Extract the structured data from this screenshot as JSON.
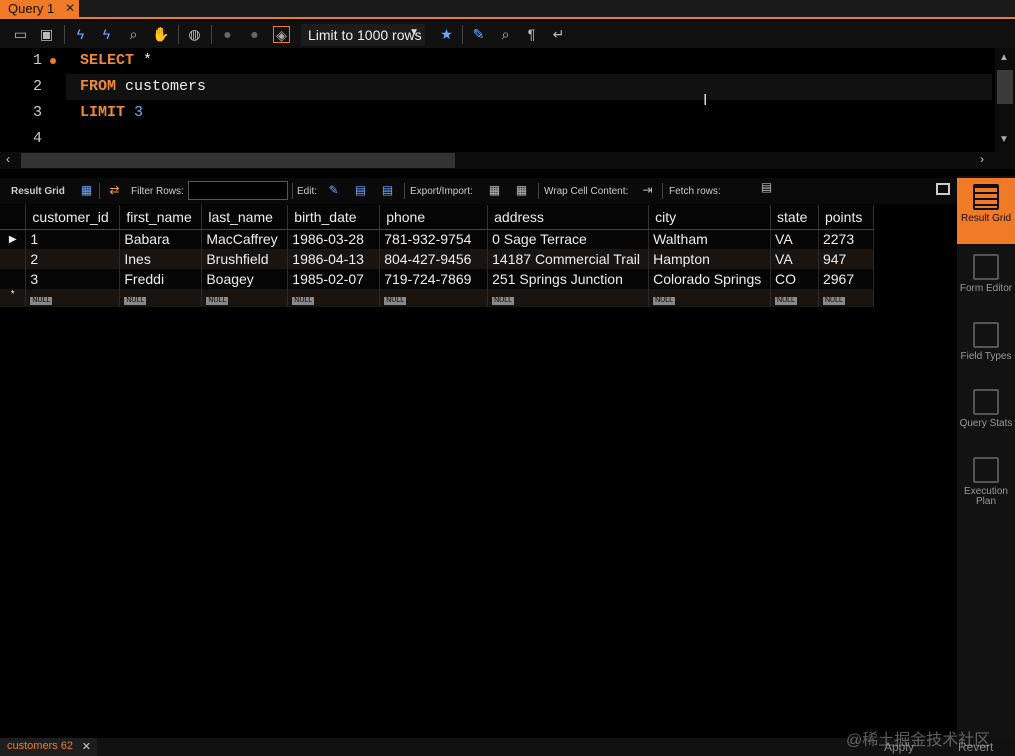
{
  "tab": {
    "title": "Query 1",
    "close": "✕"
  },
  "toolbar": {
    "limit_value": "Limit to 1000 rows"
  },
  "editor": {
    "lines": [
      {
        "number": "1",
        "keyword": "SELECT",
        "rest": " *"
      },
      {
        "number": "2",
        "keyword": "FROM",
        "rest": " customers"
      },
      {
        "number": "3",
        "keyword": "LIMIT",
        "rest": " 3"
      },
      {
        "number": "4",
        "keyword": "",
        "rest": ""
      }
    ]
  },
  "result_toolbar": {
    "result_grid": "Result Grid",
    "filter_rows": "Filter Rows:",
    "edit": "Edit:",
    "export_import": "Export/Import:",
    "wrap": "Wrap Cell Content:",
    "fetch": "Fetch rows:"
  },
  "grid": {
    "columns": [
      "customer_id",
      "first_name",
      "last_name",
      "birth_date",
      "phone",
      "address",
      "city",
      "state",
      "points"
    ],
    "rows": [
      [
        "1",
        "Babara",
        "MacCaffrey",
        "1986-03-28",
        "781-932-9754",
        "0 Sage Terrace",
        "Waltham",
        "VA",
        "2273"
      ],
      [
        "2",
        "Ines",
        "Brushfield",
        "1986-04-13",
        "804-427-9456",
        "14187 Commercial Trail",
        "Hampton",
        "VA",
        "947"
      ],
      [
        "3",
        "Freddi",
        "Boagey",
        "1985-02-07",
        "719-724-7869",
        "251 Springs Junction",
        "Colorado Springs",
        "CO",
        "2967"
      ]
    ],
    "null_label": "NULL"
  },
  "right_panel": {
    "items": [
      {
        "label": "Result Grid",
        "icon": "result-grid-icon"
      },
      {
        "label": "Form Editor",
        "icon": "form-editor-icon"
      },
      {
        "label": "Field Types",
        "icon": "field-types-icon"
      },
      {
        "label": "Query Stats",
        "icon": "query-stats-icon"
      },
      {
        "label": "Execution Plan",
        "icon": "execution-plan-icon"
      }
    ]
  },
  "bottom": {
    "tab_label": "customers 62",
    "apply": "Apply",
    "revert": "Revert"
  },
  "watermark": "@稀土掘金技术社区",
  "colors": {
    "accent": "#f07a26",
    "keyword": "#f08a3a",
    "number": "#6fa8ff"
  }
}
